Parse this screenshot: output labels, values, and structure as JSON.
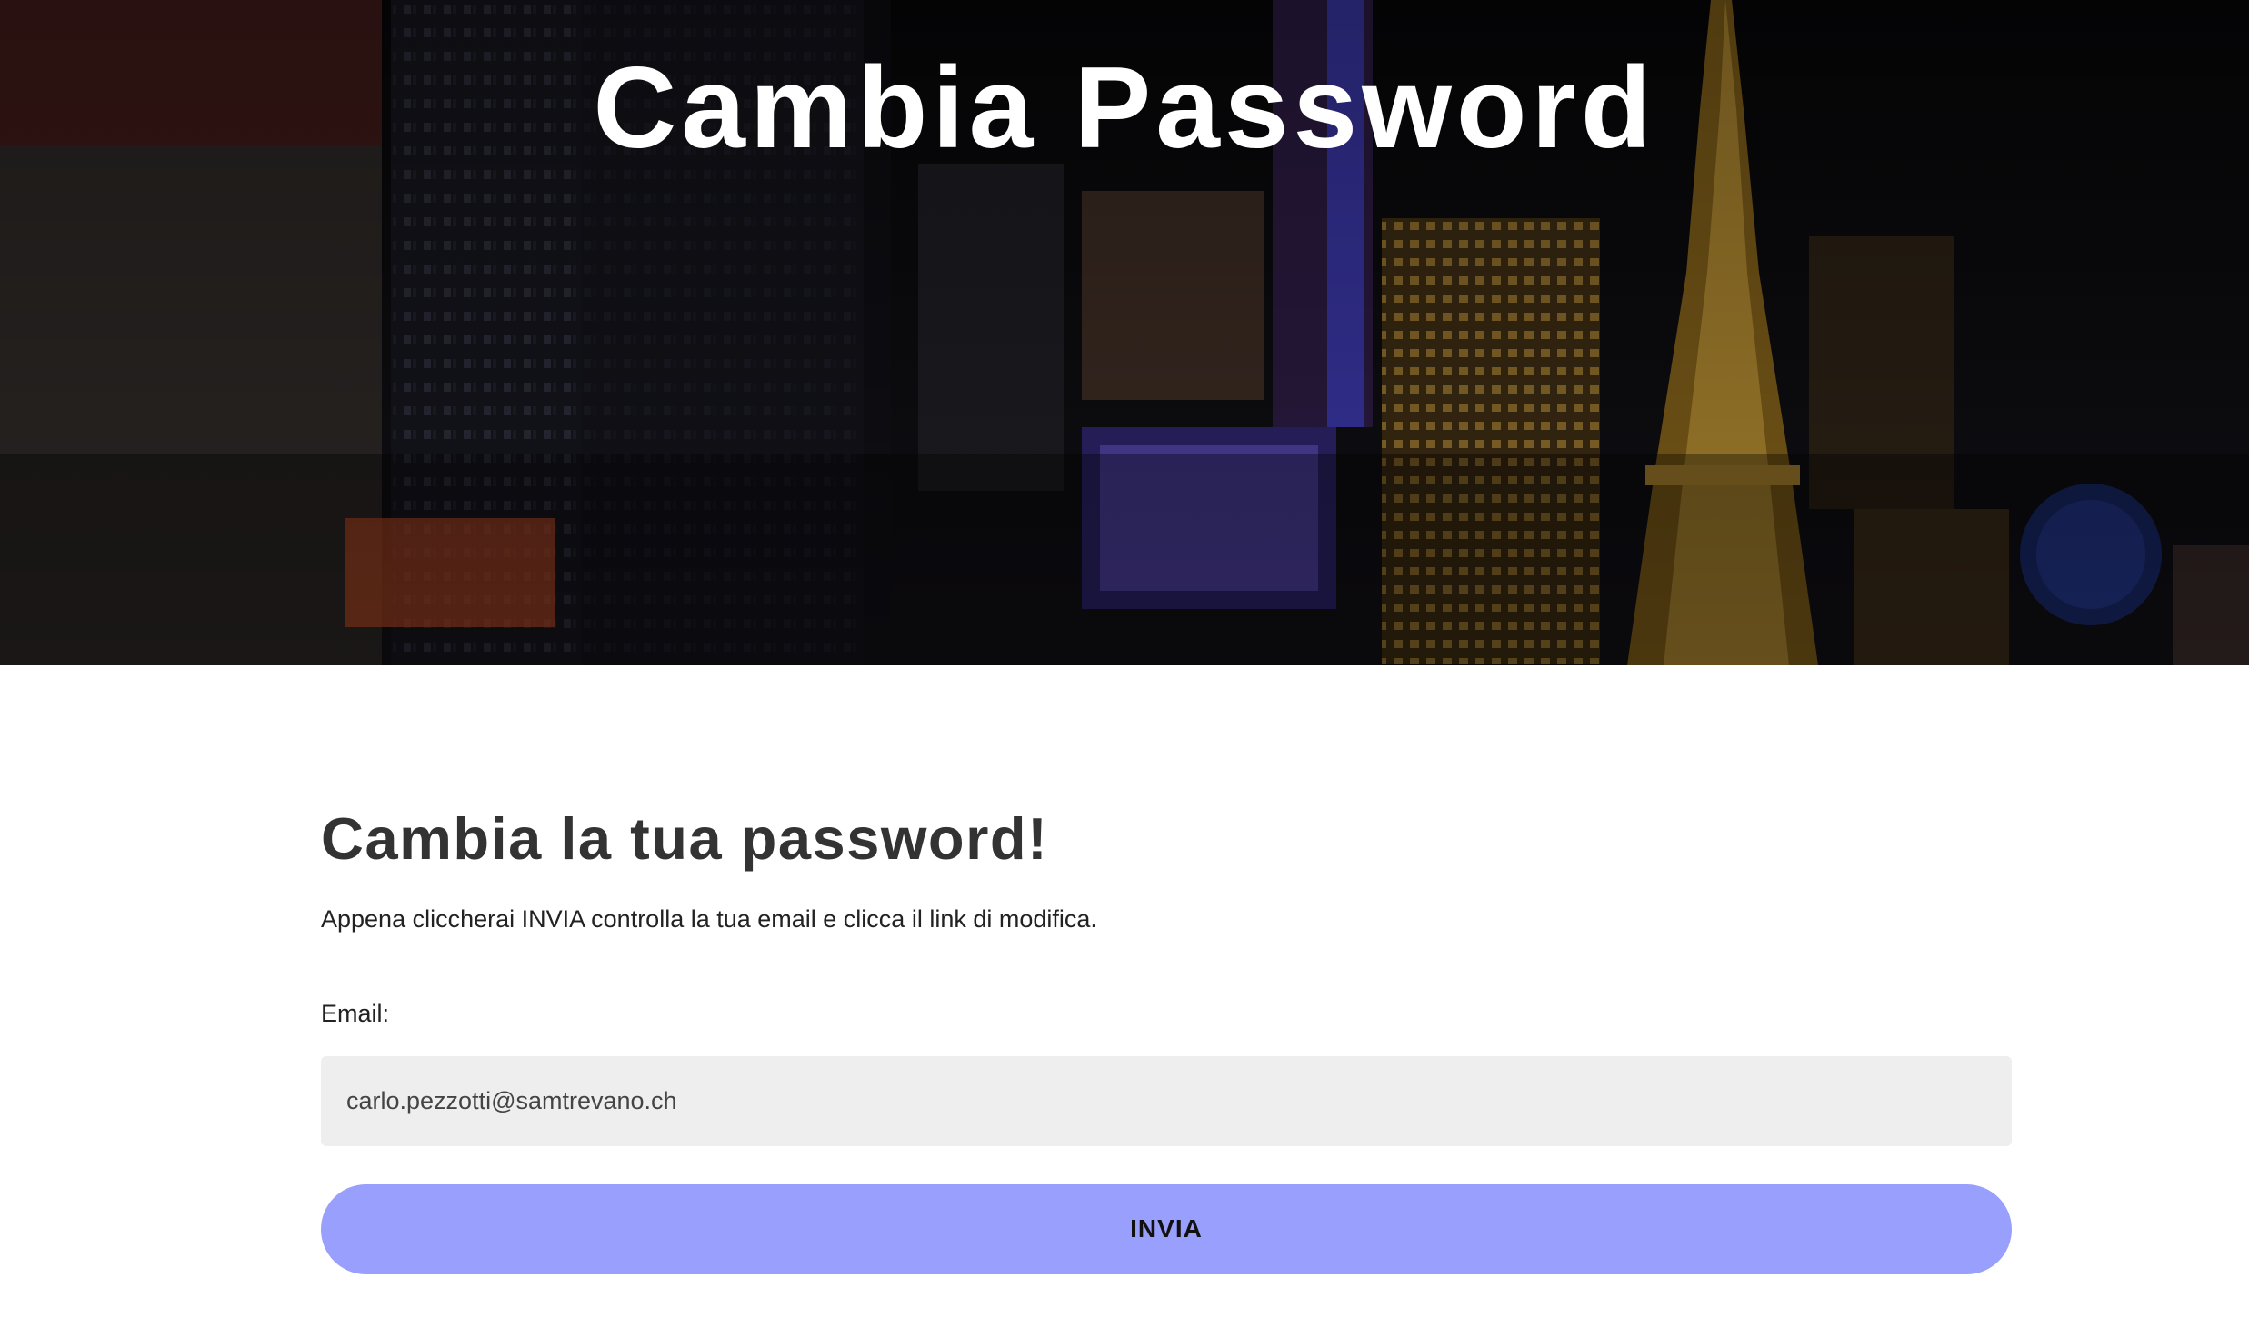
{
  "hero": {
    "title": "Cambia Password"
  },
  "form": {
    "heading": "Cambia la tua password!",
    "intro": "Appena cliccherai INVIA controlla la tua email e clicca il link di modifica.",
    "email_label": "Email:",
    "email_value": "carlo.pezzotti@samtrevano.ch",
    "submit_label": "INVIA"
  },
  "colors": {
    "button_background": "#999ffc",
    "input_background": "#eeeeee",
    "heading_text": "#333333"
  }
}
